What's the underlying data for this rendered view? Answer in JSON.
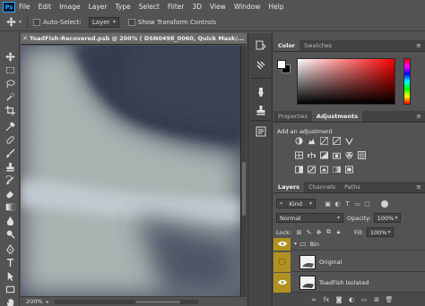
{
  "app": {
    "logo": "Ps",
    "menu": [
      "File",
      "Edit",
      "Image",
      "Layer",
      "Type",
      "Select",
      "Filter",
      "3D",
      "View",
      "Window",
      "Help"
    ]
  },
  "options_bar": {
    "auto_select_label": "Auto-Select:",
    "auto_select_value": "Layer",
    "show_transform_label": "Show Transform Controls"
  },
  "document": {
    "tab_title": "ToadFish-Recovered.psb @ 200% ( DSN0498_0060, Quick Mask/..."
  },
  "status": {
    "zoom": "200%"
  },
  "color_panel": {
    "tabs": [
      "Color",
      "Swatches"
    ],
    "foreground": "#ffffff",
    "background": "#000000"
  },
  "adjustments_panel": {
    "tabs": [
      "Properties",
      "Adjustments"
    ],
    "add_label": "Add an adjustment"
  },
  "layers_panel": {
    "tabs": [
      "Layers",
      "Channels",
      "Paths"
    ],
    "filter_kind": "Kind",
    "blend_mode": "Normal",
    "opacity_label": "Opacity:",
    "opacity_value": "100%",
    "lock_label": "Lock:",
    "fill_label": "Fill:",
    "fill_value": "100%",
    "layers": [
      {
        "name": "Bin",
        "kind": "group"
      },
      {
        "name": "Original",
        "kind": "layer"
      },
      {
        "name": "ToadFish Isolated",
        "kind": "layer"
      }
    ]
  },
  "colors": {
    "accent_eye": "#b19220",
    "panel_bg": "#535353"
  }
}
